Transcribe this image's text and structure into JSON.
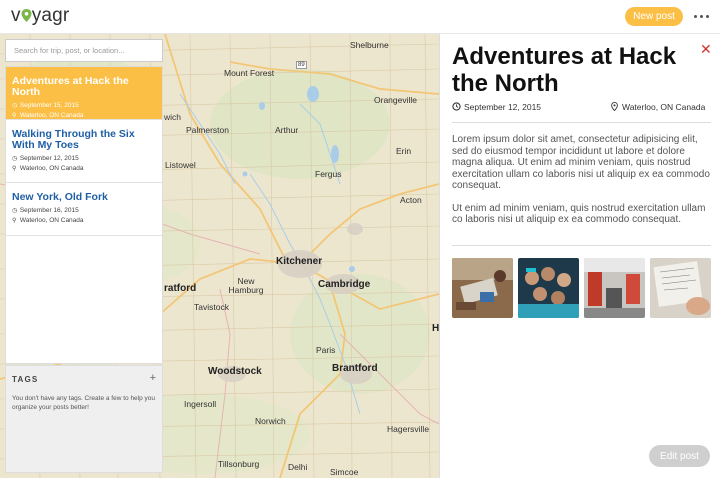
{
  "header": {
    "logo_text": "voyagr",
    "new_post_label": "New post",
    "more_icon": "ellipsis-icon"
  },
  "search": {
    "placeholder": "Search for trip, post, or location..."
  },
  "posts": [
    {
      "title": "Adventures at Hack the North",
      "date": "September 15, 2015",
      "location": "Waterloo, ON Canada",
      "active": true
    },
    {
      "title": "Walking Through the Six With My Toes",
      "date": "September 12, 2015",
      "location": "Waterloo, ON Canada",
      "active": false
    },
    {
      "title": "New York, Old Fork",
      "date": "September 16, 2015",
      "location": "Waterloo, ON Canada",
      "active": false
    }
  ],
  "tags": {
    "title": "TAGS",
    "add_label": "+",
    "empty_text": "You don't have any tags. Create a few to help you organize your posts better!"
  },
  "map": {
    "cities": [
      "Shelburne",
      "Mount Forest",
      "Orangeville",
      "Palmerston",
      "Arthur",
      "Erin",
      "Listowel",
      "Fergus",
      "Acton",
      "Kitchener",
      "New Hamburg",
      "Cambridge",
      "Tavistock",
      "Paris",
      "Woodstock",
      "Brantford",
      "Ingersoll",
      "Norwich",
      "Hagersville",
      "Tillsonburg",
      "Delhi",
      "Simcoe"
    ],
    "partial_labels": [
      "wich",
      "ratford",
      "H"
    ],
    "highway_shield": "89"
  },
  "detail": {
    "title": "Adventures at Hack the North",
    "date": "September 12, 2015",
    "location": "Waterloo, ON Canada",
    "paragraphs": [
      "Lorem ipsum dolor sit amet, consectetur adipisicing elit, sed do eiusmod tempor incididunt ut labore et dolore magna aliqua. Ut enim ad minim veniam, quis nostrud exercitation ullam co laboris nisi ut aliquip ex ea commodo consequat.",
      "Ut enim ad minim veniam, quis nostrud exercitation ullam co laboris nisi ut aliquip ex ea commodo consequat."
    ],
    "edit_label": "Edit post",
    "close_icon": "close-icon",
    "photo_count": 4
  },
  "colors": {
    "accent": "#fbbf45",
    "link": "#1f5fa6",
    "close": "#d0342c"
  }
}
